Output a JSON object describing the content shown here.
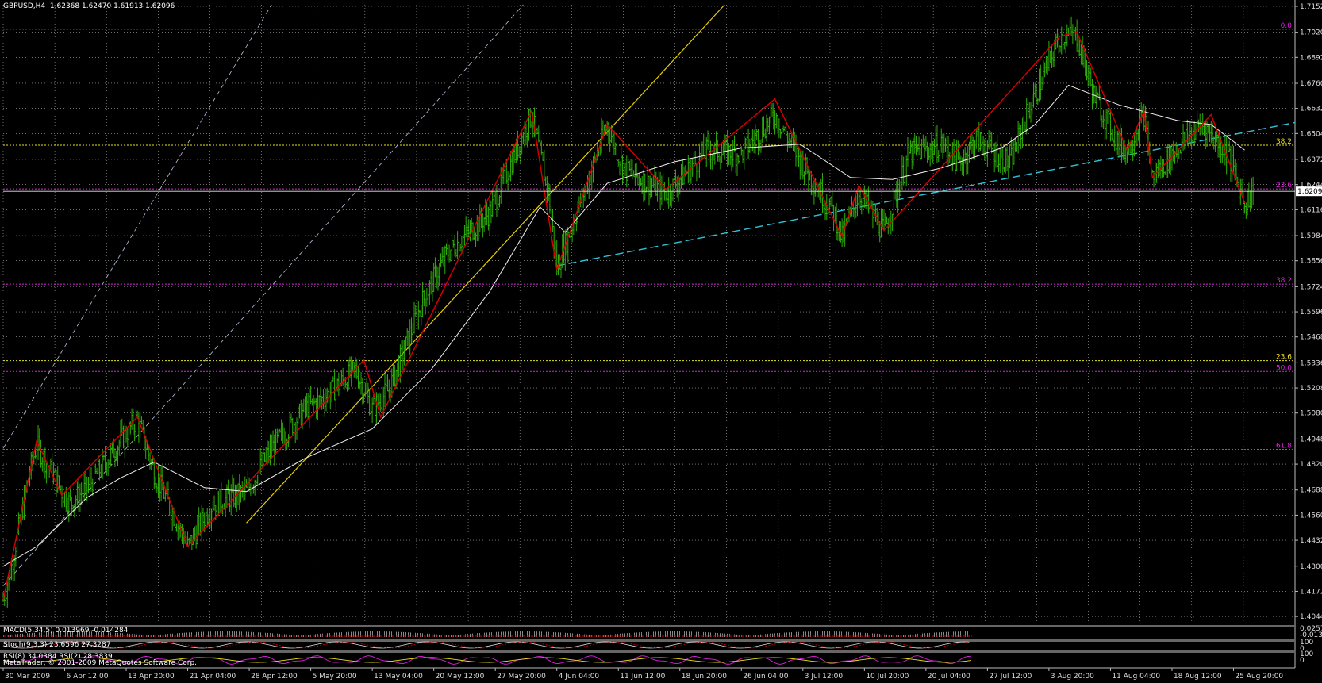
{
  "header": {
    "symbol": "GBPUSD,H4",
    "ohlc": "1.62368 1.62470 1.61913 1.62096"
  },
  "indicators": {
    "macd": "MACD(5,34,5) 0.013969 -0.014284",
    "stoch": "Stoch(9,3,3) 23.6596 27.3287",
    "rsi": "RSI(8) 34.0384 RSI(2) 28.3839",
    "copyright": "MetaTrader, © 2001-2009 MetaQuotes Software Corp.",
    "macd_scale": [
      "0.0257",
      "-0.013"
    ],
    "stoch_scale": [
      "100",
      "0"
    ],
    "rsi_scale": [
      "100",
      "0"
    ]
  },
  "colors": {
    "background": "#000000",
    "grid": "#b4b4b4",
    "bar": "#2fae0a",
    "zigzag": "#d60000",
    "ma": "#f0f0f0",
    "trendline_yellow": "#e6d000",
    "trendline_cyan": "#2fc3d6",
    "channel": "#b8c4e0",
    "fib_magenta": "#e020e0",
    "fib_yellow": "#e8e020"
  },
  "chart_data": {
    "type": "candlestick-ohlc",
    "symbol": "GBPUSD",
    "timeframe": "H4",
    "current_price": "1.62096",
    "ylim": [
      1.4,
      1.716
    ],
    "y_ticks": [
      "1.71520",
      "1.70200",
      "1.68920",
      "1.67600",
      "1.66320",
      "1.65040",
      "1.63720",
      "1.62440",
      "1.61160",
      "1.59840",
      "1.58560",
      "1.57240",
      "1.55960",
      "1.54680",
      "1.53360",
      "1.52080",
      "1.50800",
      "1.49480",
      "1.48200",
      "1.46880",
      "1.45600",
      "1.44320",
      "1.43000",
      "1.41720",
      "1.40440"
    ],
    "x_labels": [
      "30 Mar 2009",
      "6 Apr 12:00",
      "13 Apr 20:00",
      "21 Apr 04:00",
      "28 Apr 12:00",
      "5 May 20:00",
      "13 May 04:00",
      "20 May 12:00",
      "27 May 20:00",
      "4 Jun 04:00",
      "11 Jun 12:00",
      "18 Jun 20:00",
      "26 Jun 04:00",
      "3 Jul 12:00",
      "10 Jul 20:00",
      "20 Jul 04:00",
      "27 Jul 12:00",
      "3 Aug 20:00",
      "11 Aug 04:00",
      "18 Aug 12:00",
      "25 Aug 20:00"
    ],
    "price_path": [
      {
        "date": "30 Mar 2009",
        "price": 1.413
      },
      {
        "date": "31 Mar 2009",
        "price": 1.43
      },
      {
        "date": "2 Apr 2009",
        "price": 1.475
      },
      {
        "date": "3 Apr 2009",
        "price": 1.492
      },
      {
        "date": "6 Apr 2009",
        "price": 1.468
      },
      {
        "date": "7 Apr 2009",
        "price": 1.462
      },
      {
        "date": "9 Apr 2009",
        "price": 1.47
      },
      {
        "date": "13 Apr 2009",
        "price": 1.494
      },
      {
        "date": "15 Apr 2009",
        "price": 1.505
      },
      {
        "date": "17 Apr 2009",
        "price": 1.478
      },
      {
        "date": "21 Apr 2009",
        "price": 1.44
      },
      {
        "date": "24 Apr 2009",
        "price": 1.462
      },
      {
        "date": "28 Apr 2009",
        "price": 1.468
      },
      {
        "date": "1 May 2009",
        "price": 1.49
      },
      {
        "date": "5 May 2009",
        "price": 1.51
      },
      {
        "date": "7 May 2009",
        "price": 1.515
      },
      {
        "date": "11 May 2009",
        "price": 1.53
      },
      {
        "date": "13 May 2009",
        "price": 1.51
      },
      {
        "date": "15 May 2009",
        "price": 1.52
      },
      {
        "date": "19 May 2009",
        "price": 1.565
      },
      {
        "date": "22 May 2009",
        "price": 1.59
      },
      {
        "date": "27 May 2009",
        "price": 1.61
      },
      {
        "date": "1 Jun 2009",
        "price": 1.66
      },
      {
        "date": "3 Jun 2009",
        "price": 1.62
      },
      {
        "date": "4 Jun 2009",
        "price": 1.582
      },
      {
        "date": "8 Jun 2009",
        "price": 1.63
      },
      {
        "date": "10 Jun 2009",
        "price": 1.655
      },
      {
        "date": "12 Jun 2009",
        "price": 1.632
      },
      {
        "date": "17 Jun 2009",
        "price": 1.62
      },
      {
        "date": "22 Jun 2009",
        "price": 1.642
      },
      {
        "date": "26 Jun 2009",
        "price": 1.64
      },
      {
        "date": "30 Jun 2009",
        "price": 1.66
      },
      {
        "date": "3 Jul 2009",
        "price": 1.637
      },
      {
        "date": "7 Jul 2009",
        "price": 1.61
      },
      {
        "date": "8 Jul 2009",
        "price": 1.597
      },
      {
        "date": "10 Jul 2009",
        "price": 1.62
      },
      {
        "date": "13 Jul 2009",
        "price": 1.6
      },
      {
        "date": "16 Jul 2009",
        "price": 1.64
      },
      {
        "date": "20 Jul 2009",
        "price": 1.645
      },
      {
        "date": "22 Jul 2009",
        "price": 1.635
      },
      {
        "date": "24 Jul 2009",
        "price": 1.648
      },
      {
        "date": "28 Jul 2009",
        "price": 1.635
      },
      {
        "date": "30 Jul 2009",
        "price": 1.66
      },
      {
        "date": "3 Aug 2009",
        "price": 1.7
      },
      {
        "date": "5 Aug 2009",
        "price": 1.7
      },
      {
        "date": "7 Aug 2009",
        "price": 1.67
      },
      {
        "date": "10 Aug 2009",
        "price": 1.645
      },
      {
        "date": "11 Aug 2009",
        "price": 1.642
      },
      {
        "date": "13 Aug 2009",
        "price": 1.66
      },
      {
        "date": "14 Aug 2009",
        "price": 1.628
      },
      {
        "date": "18 Aug 2009",
        "price": 1.648
      },
      {
        "date": "20 Aug 2009",
        "price": 1.655
      },
      {
        "date": "23 Aug 2009",
        "price": 1.64
      },
      {
        "date": "25 Aug 2009",
        "price": 1.615
      },
      {
        "date": "26 Aug 2009",
        "price": 1.621
      }
    ],
    "zigzag": [
      {
        "date": "30 Mar 2009",
        "price": 1.413
      },
      {
        "date": "3 Apr 2009",
        "price": 1.494
      },
      {
        "date": "6 Apr 2009",
        "price": 1.466
      },
      {
        "date": "15 Apr 2009",
        "price": 1.506
      },
      {
        "date": "21 Apr 2009",
        "price": 1.44
      },
      {
        "date": "12 May 2009",
        "price": 1.535
      },
      {
        "date": "14 May 2009",
        "price": 1.506
      },
      {
        "date": "1 Jun 2009",
        "price": 1.662
      },
      {
        "date": "4 Jun 2009",
        "price": 1.581
      },
      {
        "date": "10 Jun 2009",
        "price": 1.655
      },
      {
        "date": "17 Jun 2009",
        "price": 1.622
      },
      {
        "date": "30 Jun 2009",
        "price": 1.668
      },
      {
        "date": "8 Jul 2009",
        "price": 1.598
      },
      {
        "date": "10 Jul 2009",
        "price": 1.624
      },
      {
        "date": "13 Jul 2009",
        "price": 1.601
      },
      {
        "date": "3 Aug 2009",
        "price": 1.7
      },
      {
        "date": "5 Aug 2009",
        "price": 1.702
      },
      {
        "date": "11 Aug 2009",
        "price": 1.642
      },
      {
        "date": "13 Aug 2009",
        "price": 1.662
      },
      {
        "date": "14 Aug 2009",
        "price": 1.628
      },
      {
        "date": "21 Aug 2009",
        "price": 1.66
      },
      {
        "date": "25 Aug 2009",
        "price": 1.615
      }
    ],
    "moving_average": [
      {
        "date": "30 Mar 2009",
        "price": 1.43
      },
      {
        "date": "3 Apr 2009",
        "price": 1.44
      },
      {
        "date": "9 Apr 2009",
        "price": 1.465
      },
      {
        "date": "13 Apr 2009",
        "price": 1.475
      },
      {
        "date": "17 Apr 2009",
        "price": 1.483
      },
      {
        "date": "23 Apr 2009",
        "price": 1.47
      },
      {
        "date": "28 Apr 2009",
        "price": 1.468
      },
      {
        "date": "5 May 2009",
        "price": 1.485
      },
      {
        "date": "13 May 2009",
        "price": 1.5
      },
      {
        "date": "20 May 2009",
        "price": 1.53
      },
      {
        "date": "27 May 2009",
        "price": 1.57
      },
      {
        "date": "2 Jun 2009",
        "price": 1.613
      },
      {
        "date": "5 Jun 2009",
        "price": 1.6
      },
      {
        "date": "10 Jun 2009",
        "price": 1.625
      },
      {
        "date": "18 Jun 2009",
        "price": 1.636
      },
      {
        "date": "26 Jun 2009",
        "price": 1.643
      },
      {
        "date": "3 Jul 2009",
        "price": 1.645
      },
      {
        "date": "9 Jul 2009",
        "price": 1.628
      },
      {
        "date": "14 Jul 2009",
        "price": 1.627
      },
      {
        "date": "20 Jul 2009",
        "price": 1.633
      },
      {
        "date": "27 Jul 2009",
        "price": 1.643
      },
      {
        "date": "31 Jul 2009",
        "price": 1.655
      },
      {
        "date": "4 Aug 2009",
        "price": 1.675
      },
      {
        "date": "10 Aug 2009",
        "price": 1.665
      },
      {
        "date": "17 Aug 2009",
        "price": 1.657
      },
      {
        "date": "21 Aug 2009",
        "price": 1.655
      },
      {
        "date": "25 Aug 2009",
        "price": 1.642
      }
    ],
    "trendlines": [
      {
        "type": "yellow",
        "from": {
          "date": "28 Apr 2009",
          "price": 1.452
        },
        "to": {
          "date": "24 Jun 2009",
          "price": 1.716
        }
      },
      {
        "type": "cyan-dashed",
        "from": {
          "date": "4 Jun 2009",
          "price": 1.583
        },
        "to": {
          "date": "31 Aug 2009",
          "price": 1.656
        }
      },
      {
        "type": "channel-dashed",
        "from": {
          "date": "30 Mar 2009",
          "price": 1.42
        },
        "to": {
          "date": "31 May 2009",
          "price": 1.716
        }
      },
      {
        "type": "channel-dashed",
        "from": {
          "date": "30 Mar 2009",
          "price": 1.49
        },
        "to": {
          "date": "1 May 2009",
          "price": 1.716
        }
      }
    ],
    "fib_levels": [
      {
        "label": "0.0",
        "price": 1.7035,
        "color": "magenta"
      },
      {
        "label": "38.2",
        "price": 1.6445,
        "color": "yellow"
      },
      {
        "label": "23.6",
        "price": 1.6222,
        "color": "magenta"
      },
      {
        "label": "38.2",
        "price": 1.5737,
        "color": "magenta"
      },
      {
        "label": "23.6",
        "price": 1.5347,
        "color": "yellow"
      },
      {
        "label": "50.0",
        "price": 1.5292,
        "color": "magenta"
      },
      {
        "label": "61.8",
        "price": 1.4895,
        "color": "magenta"
      }
    ]
  }
}
